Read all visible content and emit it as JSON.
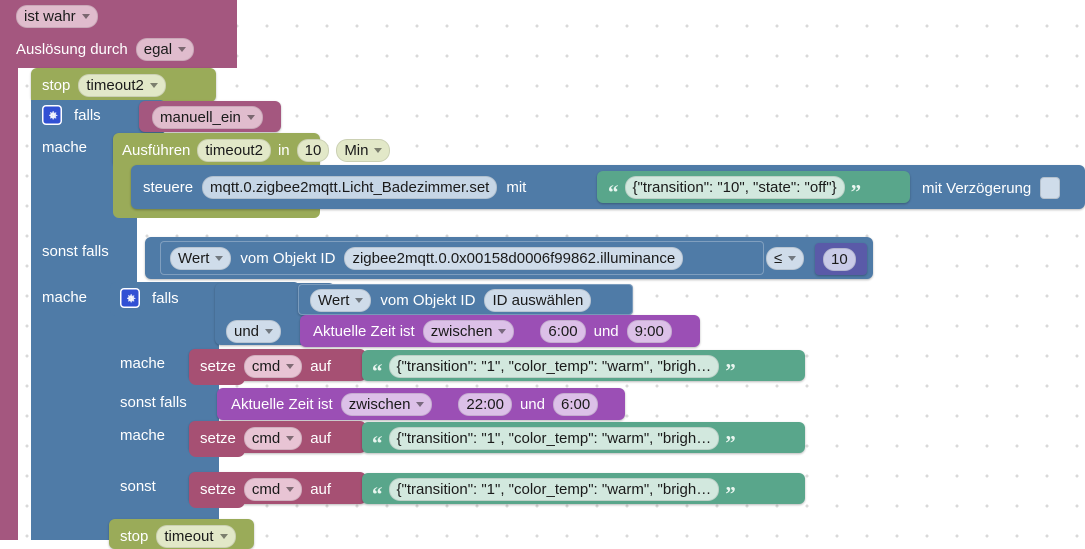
{
  "app": {
    "kind": "blockly-visual-editor",
    "language": "de"
  },
  "palette": {
    "mauve": "#a4577f",
    "olive": "#9aab59",
    "blue": "#4f7ba7",
    "green": "#59a68b",
    "purple": "#9b4fb5",
    "rose": "#a65073",
    "indigo": "#5a5aa8",
    "canvas": "#ffffff",
    "grid_dot": "#d9d9d9"
  },
  "blocks": {
    "trigger": {
      "condition_label": "ist wahr",
      "trigger_label": "Auslösung durch",
      "trigger_value": "egal"
    },
    "stop_top": {
      "keyword": "stop",
      "timer": "timeout2"
    },
    "if_outer": {
      "if_label": "falls",
      "condition_var": "manuell_ein",
      "do_label": "mache",
      "else_if_label": "sonst falls",
      "else_do_label": "mache"
    },
    "timeout_exec": {
      "keyword": "Ausführen",
      "timer": "timeout2",
      "in_label": "in",
      "amount": "10",
      "unit": "Min"
    },
    "control": {
      "keyword": "steuere",
      "object_id": "mqtt.0.zigbee2mqtt.Licht_Badezimmer.set",
      "with_label": "mit",
      "value": "{\"transition\": \"10\", \"state\": \"off\"}",
      "delay_label": "mit Verzögerung",
      "delay_checked": false
    },
    "illuminance_compare": {
      "value_selector": "Wert",
      "from_object_label": "vom Objekt ID",
      "object_id": "zigbee2mqtt.0.0x00158d0006f99862.illuminance",
      "operator": "≤",
      "number": "10"
    },
    "if_inner": {
      "if_label": "falls",
      "value_selector": "Wert",
      "from_object_label": "vom Objekt ID",
      "object_id": "ID auswählen",
      "logic_operator": "und",
      "do_label": "mache",
      "else_if_label": "sonst falls",
      "else_do_label": "mache",
      "else_label": "sonst"
    },
    "time_condition_1": {
      "prefix": "Aktuelle Zeit ist",
      "mode": "zwischen",
      "from": "6:00",
      "and_label": "und",
      "to": "9:00"
    },
    "time_condition_2": {
      "prefix": "Aktuelle Zeit ist",
      "mode": "zwischen",
      "from": "22:00",
      "and_label": "und",
      "to": "6:00"
    },
    "set_cmd_1": {
      "keyword": "setze",
      "variable": "cmd",
      "to_label": "auf",
      "value": "{\"transition\": \"1\", \"color_temp\": \"warm\", \"brigh…"
    },
    "set_cmd_2": {
      "keyword": "setze",
      "variable": "cmd",
      "to_label": "auf",
      "value": "{\"transition\": \"1\", \"color_temp\": \"warm\", \"brigh…"
    },
    "set_cmd_3": {
      "keyword": "setze",
      "variable": "cmd",
      "to_label": "auf",
      "value": "{\"transition\": \"1\", \"color_temp\": \"warm\", \"brigh…"
    },
    "stop_bottom": {
      "keyword": "stop",
      "timer": "timeout"
    }
  }
}
